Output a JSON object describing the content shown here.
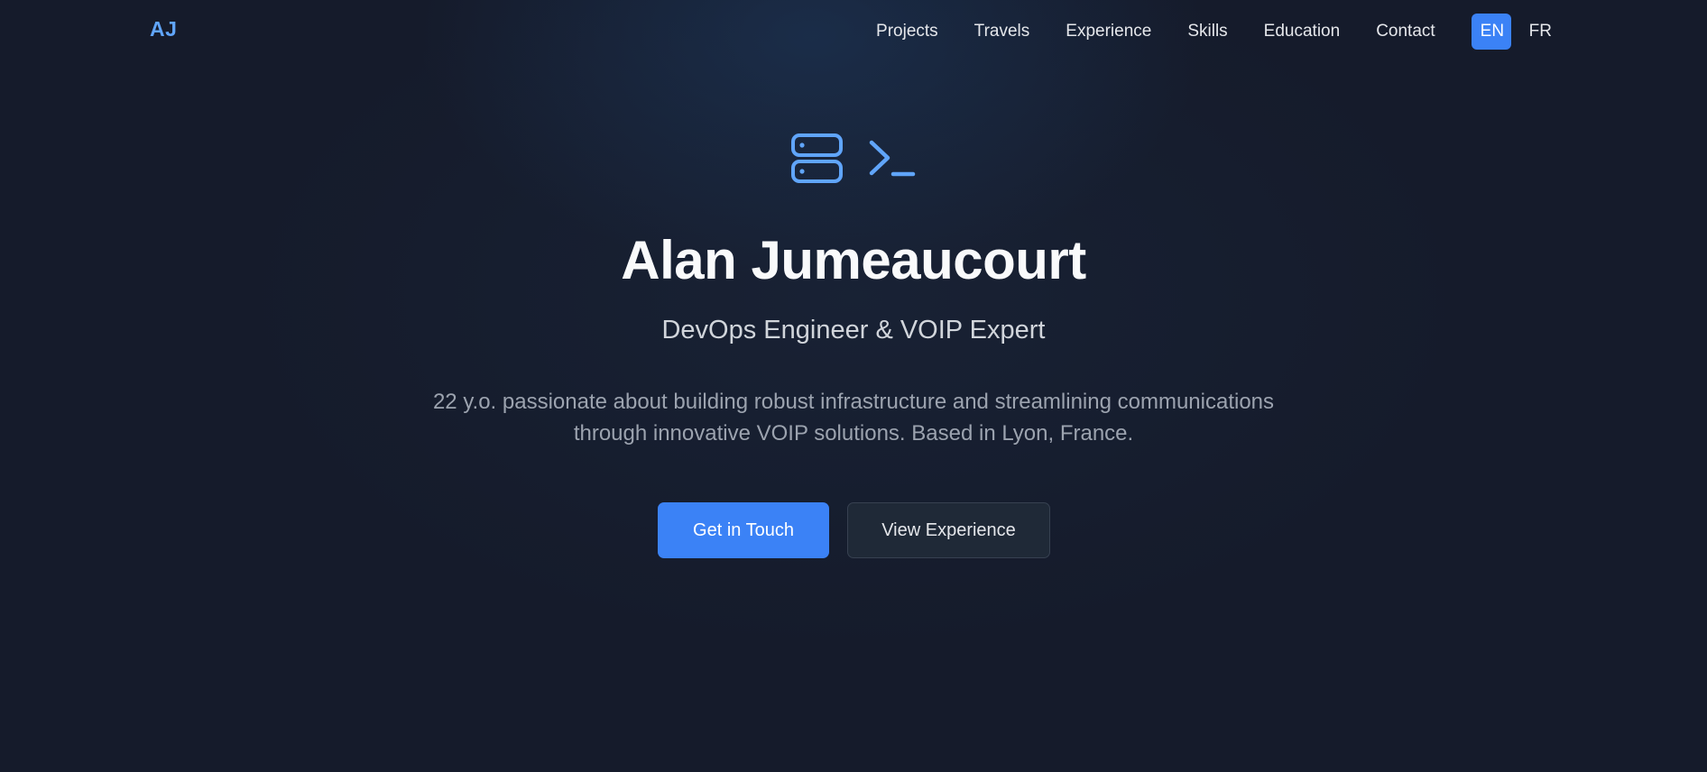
{
  "nav": {
    "logo": "AJ",
    "links": [
      "Projects",
      "Travels",
      "Experience",
      "Skills",
      "Education",
      "Contact"
    ],
    "languages": {
      "active": "EN",
      "other": "FR"
    }
  },
  "hero": {
    "icons": [
      "server-icon",
      "terminal-icon"
    ],
    "name": "Alan Jumeaucourt",
    "role": "DevOps Engineer & VOIP Expert",
    "description": "22 y.o. passionate about building robust infrastructure and streamlining communications through innovative VOIP solutions. Based in Lyon, France.",
    "primary_button": "Get in Touch",
    "secondary_button": "View Experience"
  },
  "colors": {
    "background": "#151b2b",
    "accent": "#3b82f6",
    "logo": "#60a5fa",
    "icon": "#60a5fa"
  }
}
